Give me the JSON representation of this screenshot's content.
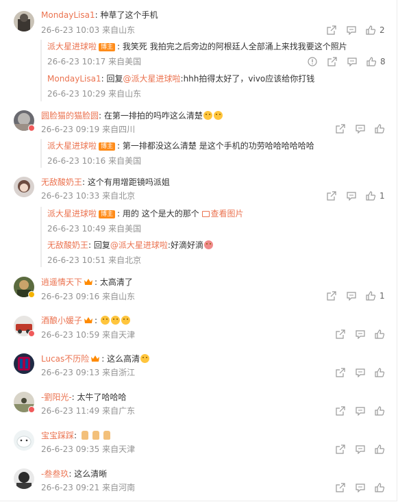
{
  "comments": [
    {
      "user": "MondayLisa1",
      "text": "种草了这个手机",
      "time": "26-6-23 10:03",
      "location": "来自山东",
      "likes": "2",
      "replies": [
        {
          "user": "派大星进球啦",
          "tag": "博主",
          "text": "我笑死 我拍完之后旁边的阿根廷人全部涌上来找我要这个照片",
          "time": "26-6-23 10:17",
          "location": "来自美国",
          "likes": "8"
        },
        {
          "user": "MondayLisa1",
          "reply_prefix": "回复",
          "mention": "@派大星进球啦",
          "text": "hhh拍得太好了，vivo应该给你打钱",
          "time": "26-6-23 10:29",
          "location": "来自山东"
        }
      ]
    },
    {
      "user": "圆脸猫的猫脸圆",
      "text": "在第一排拍的吗咋这么清楚",
      "time": "26-6-23 09:19",
      "location": "来自四川",
      "replies": [
        {
          "user": "派大星进球啦",
          "tag": "博主",
          "text": "第一排都没这么清楚 是这个手机的功劳哈哈哈哈哈哈",
          "time": "26-6-23 10:16",
          "location": "来自美国"
        }
      ]
    },
    {
      "user": "无敌酸奶王",
      "text": "这个有用增距镜吗派姐",
      "time": "26-6-23 10:33",
      "location": "来自北京",
      "likes": "1",
      "replies": [
        {
          "user": "派大星进球啦",
          "tag": "博主",
          "text": "用的 这个是大的那个",
          "link": "查看图片",
          "time": "26-6-23 10:49",
          "location": "来自美国"
        },
        {
          "user": "无敌酸奶王",
          "reply_prefix": "回复",
          "mention": "@派大星进球啦",
          "text": "好滴好滴",
          "time": "26-6-23 10:51",
          "location": "来自北京"
        }
      ]
    },
    {
      "user": "逍遥情天下",
      "text": "太高清了",
      "time": "26-6-23 09:16",
      "location": "来自山东",
      "likes": "1"
    },
    {
      "user": "酒酿小媛子",
      "text": "",
      "time": "26-6-23 10:59",
      "location": "来自天津"
    },
    {
      "user": "Lucas不历险",
      "text": "这么高清",
      "time": "26-6-23 09:13",
      "location": "来自浙江"
    },
    {
      "user": "-劉阳光-",
      "text": "太牛了哈哈哈",
      "time": "26-6-23 11:49",
      "location": "来自广东"
    },
    {
      "user": "宝宝踩踩",
      "text": "",
      "time": "26-6-23 09:35",
      "location": "来自天津"
    },
    {
      "user": "-叁叁玖",
      "text": "这么清晰",
      "time": "26-6-23 09:21",
      "location": "来自河南"
    }
  ],
  "icons": {
    "share": "share-icon",
    "comment": "comment-icon",
    "like": "like-icon",
    "report": "report-icon"
  },
  "colors": {
    "username": "#eb7350",
    "meta": "#939393",
    "tag": "#ff8c1a"
  }
}
